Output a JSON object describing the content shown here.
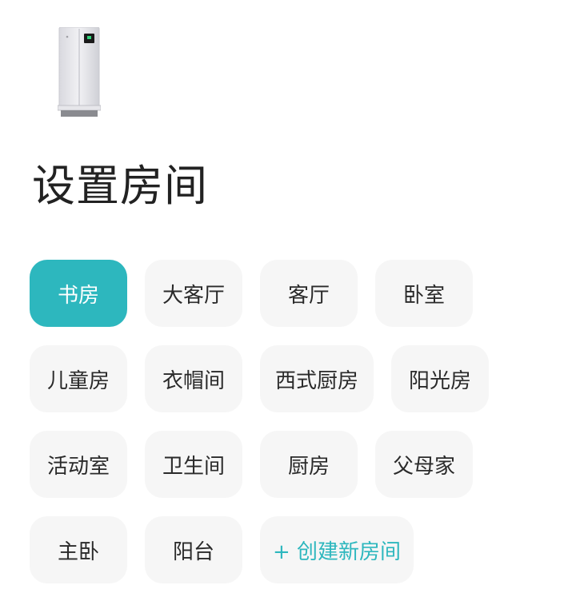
{
  "page": {
    "title": "设置房间"
  },
  "colors": {
    "accent": "#2db7be",
    "chip_bg": "#f6f6f6",
    "text": "#222222"
  },
  "rooms": {
    "row1": [
      "书房",
      "大客厅",
      "客厅",
      "卧室"
    ],
    "row2": [
      "儿童房",
      "衣帽间",
      "西式厨房",
      "阳光房"
    ],
    "row3": [
      "活动室",
      "卫生间",
      "厨房",
      "父母家"
    ],
    "row4": [
      "主卧",
      "阳台"
    ],
    "selected": "书房",
    "create_label": "+ 创建新房间"
  },
  "device": {
    "icon": "air-purifier-icon"
  }
}
